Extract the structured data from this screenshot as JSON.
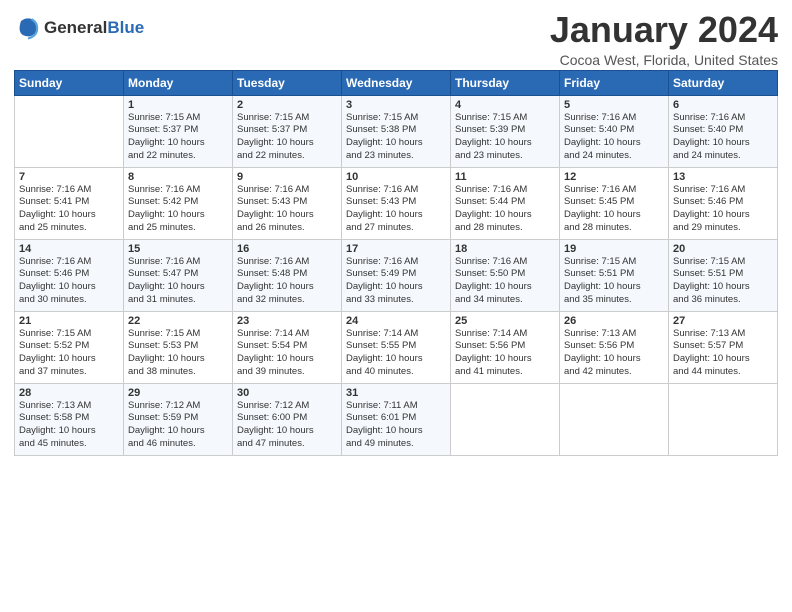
{
  "header": {
    "logo_line1": "General",
    "logo_line2": "Blue",
    "title": "January 2024",
    "location": "Cocoa West, Florida, United States"
  },
  "days_of_week": [
    "Sunday",
    "Monday",
    "Tuesday",
    "Wednesday",
    "Thursday",
    "Friday",
    "Saturday"
  ],
  "weeks": [
    [
      {
        "day": "",
        "info": ""
      },
      {
        "day": "1",
        "info": "Sunrise: 7:15 AM\nSunset: 5:37 PM\nDaylight: 10 hours\nand 22 minutes."
      },
      {
        "day": "2",
        "info": "Sunrise: 7:15 AM\nSunset: 5:37 PM\nDaylight: 10 hours\nand 22 minutes."
      },
      {
        "day": "3",
        "info": "Sunrise: 7:15 AM\nSunset: 5:38 PM\nDaylight: 10 hours\nand 23 minutes."
      },
      {
        "day": "4",
        "info": "Sunrise: 7:15 AM\nSunset: 5:39 PM\nDaylight: 10 hours\nand 23 minutes."
      },
      {
        "day": "5",
        "info": "Sunrise: 7:16 AM\nSunset: 5:40 PM\nDaylight: 10 hours\nand 24 minutes."
      },
      {
        "day": "6",
        "info": "Sunrise: 7:16 AM\nSunset: 5:40 PM\nDaylight: 10 hours\nand 24 minutes."
      }
    ],
    [
      {
        "day": "7",
        "info": "Sunrise: 7:16 AM\nSunset: 5:41 PM\nDaylight: 10 hours\nand 25 minutes."
      },
      {
        "day": "8",
        "info": "Sunrise: 7:16 AM\nSunset: 5:42 PM\nDaylight: 10 hours\nand 25 minutes."
      },
      {
        "day": "9",
        "info": "Sunrise: 7:16 AM\nSunset: 5:43 PM\nDaylight: 10 hours\nand 26 minutes."
      },
      {
        "day": "10",
        "info": "Sunrise: 7:16 AM\nSunset: 5:43 PM\nDaylight: 10 hours\nand 27 minutes."
      },
      {
        "day": "11",
        "info": "Sunrise: 7:16 AM\nSunset: 5:44 PM\nDaylight: 10 hours\nand 28 minutes."
      },
      {
        "day": "12",
        "info": "Sunrise: 7:16 AM\nSunset: 5:45 PM\nDaylight: 10 hours\nand 28 minutes."
      },
      {
        "day": "13",
        "info": "Sunrise: 7:16 AM\nSunset: 5:46 PM\nDaylight: 10 hours\nand 29 minutes."
      }
    ],
    [
      {
        "day": "14",
        "info": "Sunrise: 7:16 AM\nSunset: 5:46 PM\nDaylight: 10 hours\nand 30 minutes."
      },
      {
        "day": "15",
        "info": "Sunrise: 7:16 AM\nSunset: 5:47 PM\nDaylight: 10 hours\nand 31 minutes."
      },
      {
        "day": "16",
        "info": "Sunrise: 7:16 AM\nSunset: 5:48 PM\nDaylight: 10 hours\nand 32 minutes."
      },
      {
        "day": "17",
        "info": "Sunrise: 7:16 AM\nSunset: 5:49 PM\nDaylight: 10 hours\nand 33 minutes."
      },
      {
        "day": "18",
        "info": "Sunrise: 7:16 AM\nSunset: 5:50 PM\nDaylight: 10 hours\nand 34 minutes."
      },
      {
        "day": "19",
        "info": "Sunrise: 7:15 AM\nSunset: 5:51 PM\nDaylight: 10 hours\nand 35 minutes."
      },
      {
        "day": "20",
        "info": "Sunrise: 7:15 AM\nSunset: 5:51 PM\nDaylight: 10 hours\nand 36 minutes."
      }
    ],
    [
      {
        "day": "21",
        "info": "Sunrise: 7:15 AM\nSunset: 5:52 PM\nDaylight: 10 hours\nand 37 minutes."
      },
      {
        "day": "22",
        "info": "Sunrise: 7:15 AM\nSunset: 5:53 PM\nDaylight: 10 hours\nand 38 minutes."
      },
      {
        "day": "23",
        "info": "Sunrise: 7:14 AM\nSunset: 5:54 PM\nDaylight: 10 hours\nand 39 minutes."
      },
      {
        "day": "24",
        "info": "Sunrise: 7:14 AM\nSunset: 5:55 PM\nDaylight: 10 hours\nand 40 minutes."
      },
      {
        "day": "25",
        "info": "Sunrise: 7:14 AM\nSunset: 5:56 PM\nDaylight: 10 hours\nand 41 minutes."
      },
      {
        "day": "26",
        "info": "Sunrise: 7:13 AM\nSunset: 5:56 PM\nDaylight: 10 hours\nand 42 minutes."
      },
      {
        "day": "27",
        "info": "Sunrise: 7:13 AM\nSunset: 5:57 PM\nDaylight: 10 hours\nand 44 minutes."
      }
    ],
    [
      {
        "day": "28",
        "info": "Sunrise: 7:13 AM\nSunset: 5:58 PM\nDaylight: 10 hours\nand 45 minutes."
      },
      {
        "day": "29",
        "info": "Sunrise: 7:12 AM\nSunset: 5:59 PM\nDaylight: 10 hours\nand 46 minutes."
      },
      {
        "day": "30",
        "info": "Sunrise: 7:12 AM\nSunset: 6:00 PM\nDaylight: 10 hours\nand 47 minutes."
      },
      {
        "day": "31",
        "info": "Sunrise: 7:11 AM\nSunset: 6:01 PM\nDaylight: 10 hours\nand 49 minutes."
      },
      {
        "day": "",
        "info": ""
      },
      {
        "day": "",
        "info": ""
      },
      {
        "day": "",
        "info": ""
      }
    ]
  ]
}
